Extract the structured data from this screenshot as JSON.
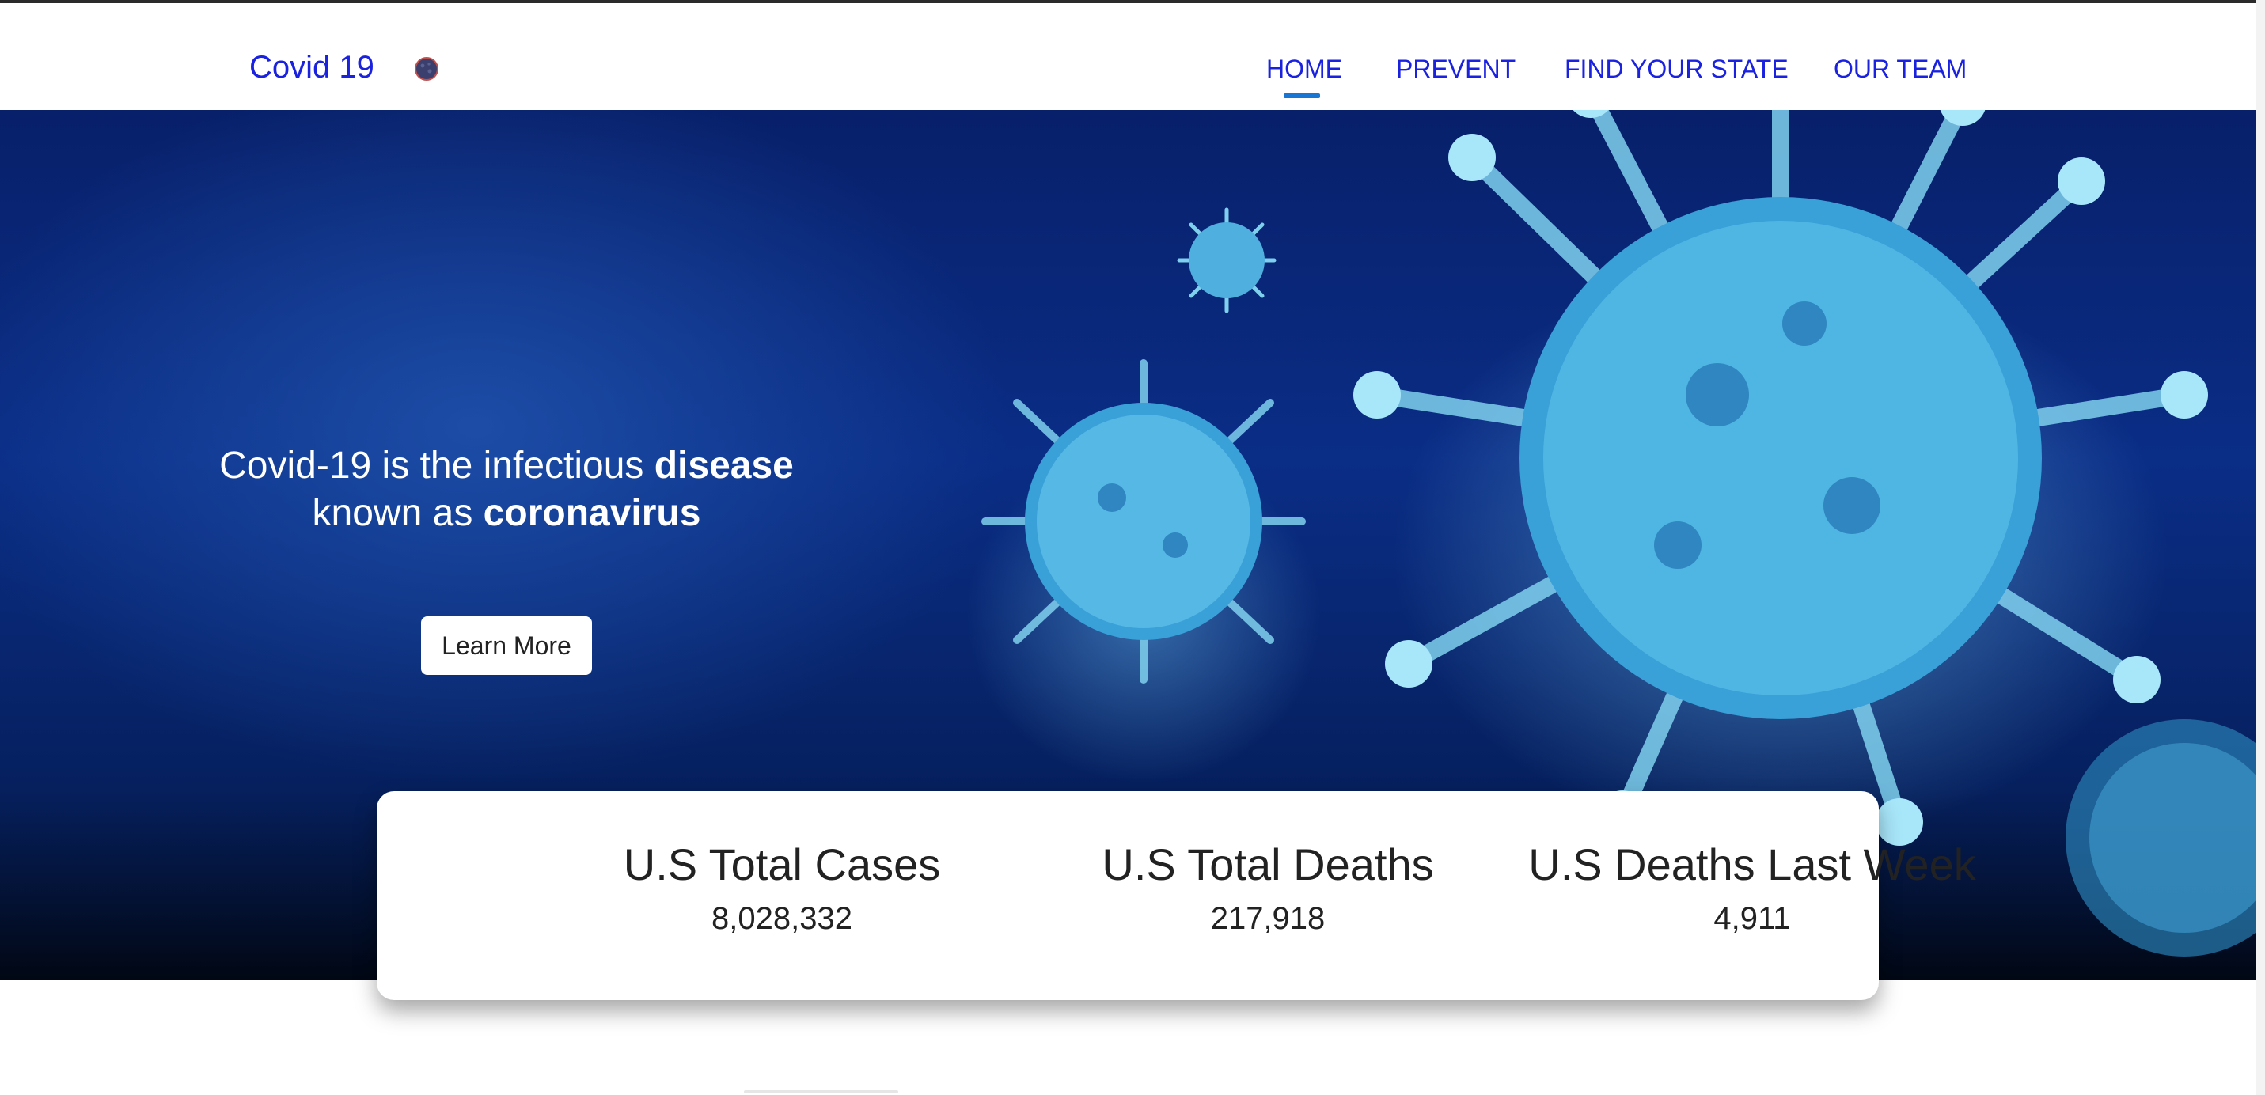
{
  "navbar": {
    "brand": "Covid 19",
    "brand_icon": "coronavirus-icon",
    "links": [
      {
        "label": "HOME",
        "active": true
      },
      {
        "label": "PREVENT",
        "active": false
      },
      {
        "label": "FIND YOUR STATE",
        "active": false
      },
      {
        "label": "OUR TEAM",
        "active": false
      }
    ]
  },
  "hero": {
    "line1_prefix": "Covid-19 is the infectious ",
    "line1_bold": "disease",
    "line2_prefix": "known as ",
    "line2_bold": "coronavirus",
    "cta_label": "Learn More",
    "background_image": "coronavirus-microscopy-image"
  },
  "stats": [
    {
      "title": "U.S Total Cases",
      "value": "8,028,332"
    },
    {
      "title": "U.S Total Deaths",
      "value": "217,918"
    },
    {
      "title": "U.S Deaths Last Week",
      "value": "4,911"
    }
  ],
  "colors": {
    "nav_link": "#1a22e0",
    "active_underline": "#1976d2",
    "hero_dark": "#0a2d86"
  }
}
